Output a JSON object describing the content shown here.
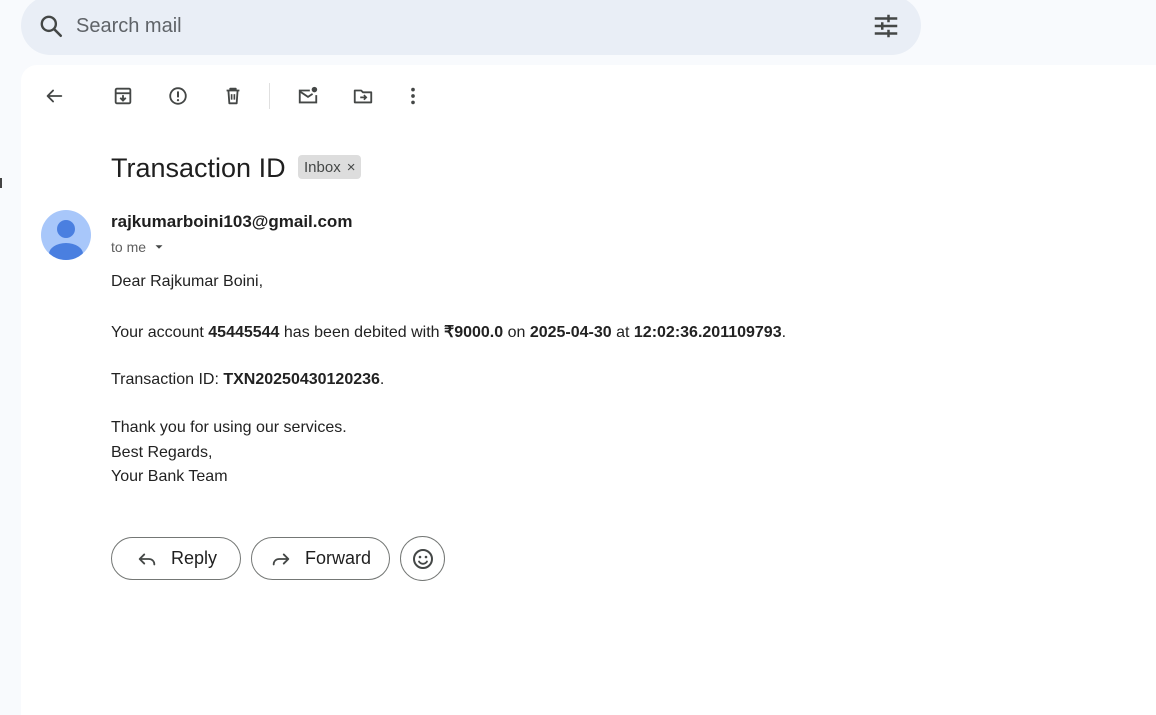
{
  "search": {
    "placeholder": "Search mail"
  },
  "email": {
    "subject": "Transaction ID",
    "label": "Inbox",
    "label_close": "×",
    "sender": "rajkumarboini103@gmail.com",
    "recipient": "to me",
    "greeting": "Dear Rajkumar Boini,",
    "line1": {
      "t1": "Your account ",
      "account": "45445544",
      "t2": " has been debited with ",
      "amount": "₹9000.0",
      "t3": " on ",
      "date": "2025-04-30",
      "t4": " at ",
      "time": "12:02:36.201109793",
      "t5": "."
    },
    "line2": {
      "t1": "Transaction ID: ",
      "txn": "TXN20250430120236",
      "t2": "."
    },
    "thanks": "Thank you for using our services.",
    "regards": "Best Regards,",
    "signature": "Your Bank Team"
  },
  "actions": {
    "reply": "Reply",
    "forward": "Forward"
  },
  "colors": {
    "accent_avatar": "#a8c7fa",
    "avatar_figure": "#4a7fe0",
    "search_bg": "#e9eef6"
  }
}
